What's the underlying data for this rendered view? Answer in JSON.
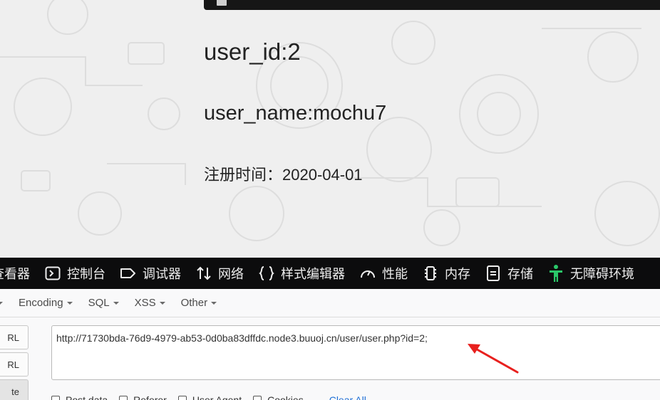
{
  "page": {
    "user_id": "user_id:2",
    "user_name": "user_name:mochu7",
    "register_time": "注册时间：2020-04-01"
  },
  "devtools": {
    "tabs": [
      {
        "label": "查看器",
        "icon": "inspector-icon"
      },
      {
        "label": "控制台",
        "icon": "console-icon"
      },
      {
        "label": "调试器",
        "icon": "debugger-icon"
      },
      {
        "label": "网络",
        "icon": "network-icon"
      },
      {
        "label": "样式编辑器",
        "icon": "style-editor-icon"
      },
      {
        "label": "性能",
        "icon": "performance-icon"
      },
      {
        "label": "内存",
        "icon": "memory-icon"
      },
      {
        "label": "存储",
        "icon": "storage-icon"
      },
      {
        "label": "无障碍环境",
        "icon": "accessibility-icon"
      }
    ]
  },
  "hackbar": {
    "menu": [
      "Encoding",
      "SQL",
      "XSS",
      "Other"
    ],
    "side_buttons": [
      "RL",
      "RL",
      "te"
    ],
    "url_value": "http://71730bda-76d9-4979-ab53-0d0ba83dffdc.node3.buuoj.cn/user/user.php?id=2;",
    "checkboxes": [
      "Post data",
      "Referer",
      "User Agent",
      "Cookies"
    ],
    "clear_all": "Clear All"
  },
  "colors": {
    "devtools_bg": "#0c0c0d",
    "accessibility_green": "#2ac769",
    "arrow_red": "#e8201e",
    "link_blue": "#1f6fd6"
  }
}
